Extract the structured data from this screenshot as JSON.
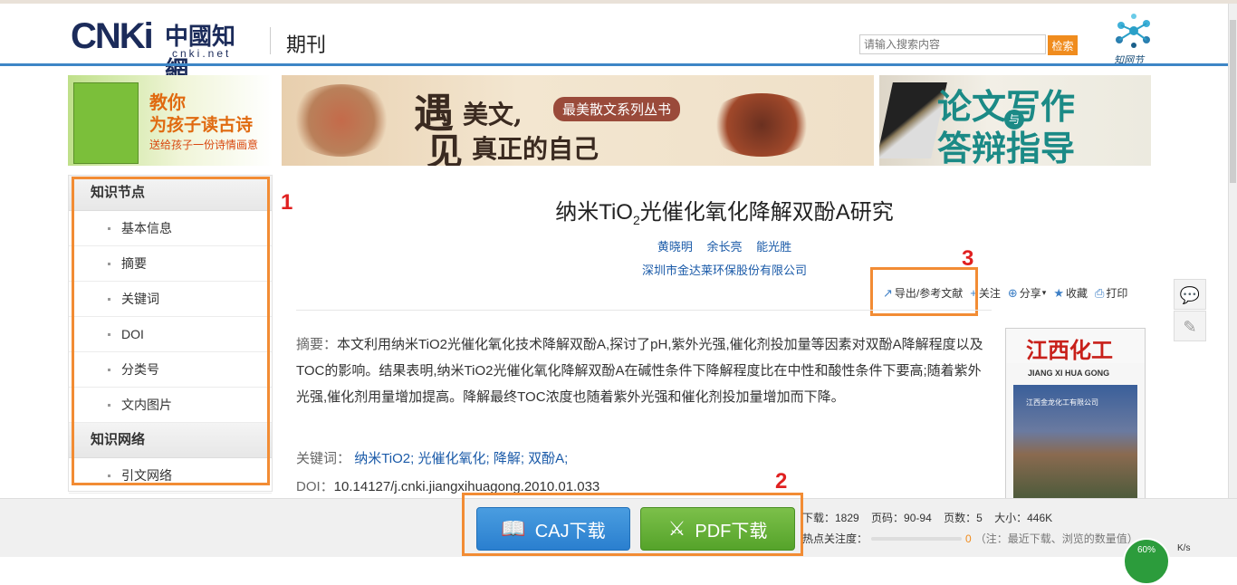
{
  "header": {
    "logo_main": "CNKi",
    "logo_cn": "中國知網",
    "logo_net": "cnki.net",
    "channel": "期刊",
    "search_placeholder": "请输入搜索内容",
    "search_button": "检索",
    "zhiwangjie_label": "知网节"
  },
  "ads": {
    "ad1": {
      "line1": "教你",
      "line2": "为孩子读古诗",
      "line3": "送给孩子一份诗情画意"
    },
    "ad2": {
      "big1": "遇",
      "small1": "美文,",
      "pill": "最美散文系列丛书",
      "big2": "见",
      "small2": "真正的自己"
    },
    "ad3": {
      "line1": "论文写作",
      "badge": "与",
      "line2": "答辩指导"
    }
  },
  "sidebar": {
    "section1": "知识节点",
    "items1": [
      "基本信息",
      "摘要",
      "关键词",
      "DOI",
      "分类号",
      "文内图片"
    ],
    "section2": "知识网络",
    "items2": [
      "引文网络"
    ]
  },
  "annotations": {
    "n1": "1",
    "n2": "2",
    "n3": "3"
  },
  "article": {
    "title_pre": "纳米TiO",
    "title_sub": "2",
    "title_post": "光催化氧化降解双酚A研究",
    "authors": [
      "黄晓明",
      "余长亮",
      "能光胜"
    ],
    "org": "深圳市金达莱环保股份有限公司",
    "tools": {
      "export": "导出/参考文献",
      "follow": "关注",
      "share": "分享",
      "favorite": "收藏",
      "print": "打印"
    },
    "abstract_label": "摘要：",
    "abstract_text": "本文利用纳米TiO2光催化氧化技术降解双酚A,探讨了pH,紫外光强,催化剂投加量等因素对双酚A降解程度以及TOC的影响。结果表明,纳米TiO2光催化氧化降解双酚A在碱性条件下降解程度比在中性和酸性条件下要高;随着紫外光强,催化剂用量增加提高。降解最终TOC浓度也随着紫外光强和催化剂投加量增加而下降。",
    "keywords_label": "关键词：",
    "keywords": [
      "纳米TiO2;",
      "光催化氧化;",
      "降解;",
      "双酚A;"
    ],
    "doi_label": "DOI：",
    "doi": "10.14127/j.cnki.jiangxihuagong.2010.01.033"
  },
  "cover": {
    "title": "江西化工",
    "pinyin": "JIANG XI HUA GONG",
    "company": "江西金龙化工有限公司"
  },
  "footer": {
    "caj_button": "CAJ下载",
    "pdf_button": "PDF下载",
    "downloads": "下载：1829",
    "pages_range": "页码：90-94",
    "page_count": "页数：5",
    "size": "大小：446K",
    "attention_label": "热点关注度：",
    "attention_value": "0",
    "attention_note": "（注：最近下载、浏览的数量值）",
    "percent": "60%",
    "speed": "K/s"
  }
}
